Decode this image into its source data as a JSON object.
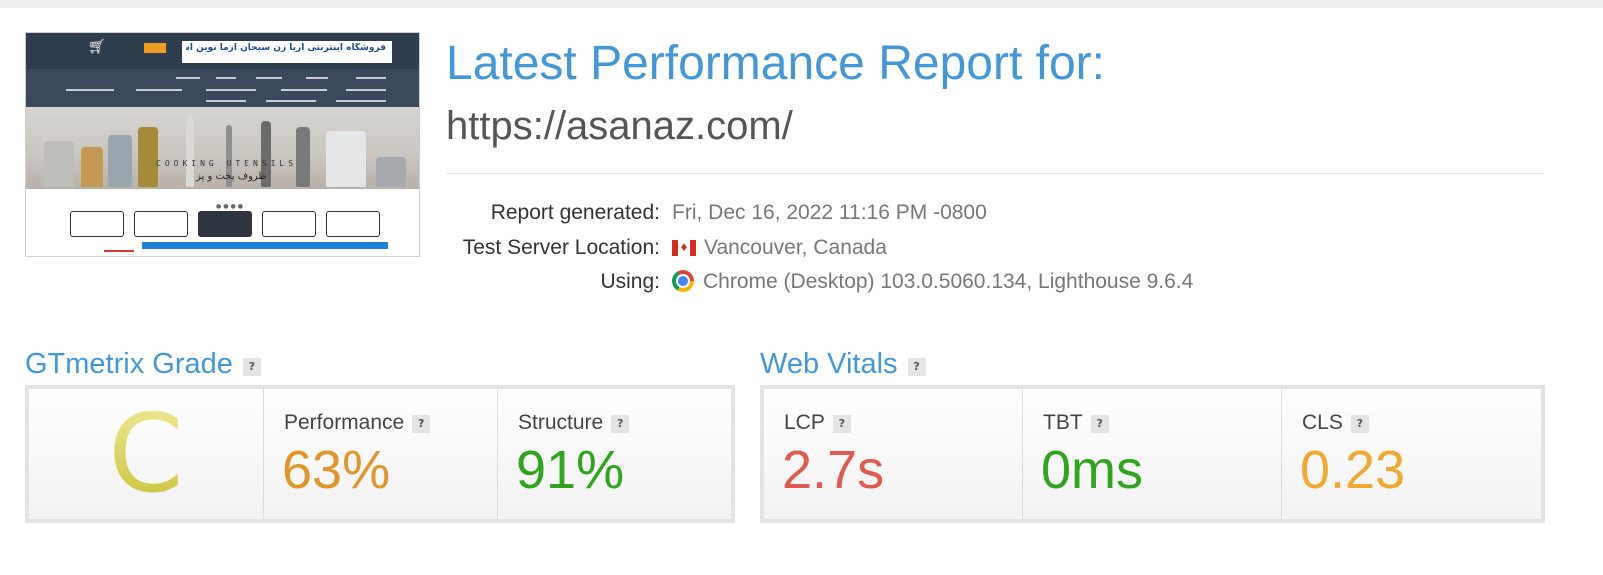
{
  "report": {
    "title": "Latest Performance Report for:",
    "url": "https://asanaz.com/",
    "generated_label": "Report generated:",
    "generated_value": "Fri, Dec 16, 2022 11:16 PM -0800",
    "location_label": "Test Server Location:",
    "location_value": "Vancouver, Canada",
    "using_label": "Using:",
    "using_value": "Chrome (Desktop) 103.0.5060.134, Lighthouse 9.6.4"
  },
  "thumbnail": {
    "banner_text": "فروشگاه اینترنتی آریا زن سبحان آزما نوین آسان",
    "hero_text_en": "COOKING UTENSILS",
    "hero_text_fa": "ظروف پخت و پز"
  },
  "grade": {
    "section_title": "GTmetrix Grade",
    "help": "?",
    "letter": "C",
    "performance_label": "Performance",
    "performance_value": "63%",
    "structure_label": "Structure",
    "structure_value": "91%"
  },
  "vitals": {
    "section_title": "Web Vitals",
    "help": "?",
    "lcp_label": "LCP",
    "lcp_value": "2.7s",
    "tbt_label": "TBT",
    "tbt_value": "0ms",
    "cls_label": "CLS",
    "cls_value": "0.23"
  },
  "colors": {
    "accent": "#4197d8",
    "grade_c": "#d4ca45",
    "performance": "#e0962a",
    "structure": "#2fa51c",
    "lcp": "#e05a4f",
    "tbt": "#2fa51c",
    "cls": "#f0a830"
  },
  "icons": {
    "flag": "canada-flag-icon",
    "browser": "chrome-icon",
    "help": "question-mark-icon"
  }
}
